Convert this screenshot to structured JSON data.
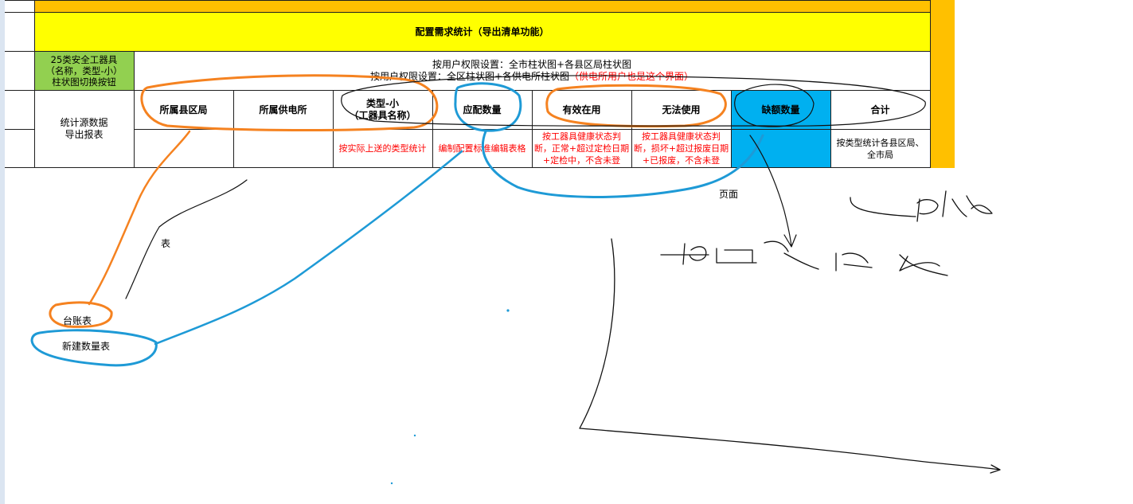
{
  "sheet": {
    "title": "配置需求统计（导出清单功能）",
    "green_button": {
      "line1": "25类安全工器具",
      "line2": "（名称，类型-小）",
      "line3": "柱状图切换按钮"
    },
    "permission_line1": "按用户权限设置：全市柱状图+各县区局柱状图",
    "permission_line2_prefix": "按用户权限设置：全区柱状图+各供电所柱状图",
    "permission_line2_red": "（供电所用户也是这个界面",
    "permission_line2_suffix": "）",
    "export_label_line1": "统计源数据",
    "export_label_line2": "导出报表",
    "headers": {
      "county": "所属县区局",
      "station": "所属供电所",
      "type_line1": "类型-小",
      "type_line2": "（工器具名称）",
      "required": "应配数量",
      "valid": "有效在用",
      "unusable": "无法使用",
      "shortage": "缺额数量",
      "total": "合计"
    },
    "notes": {
      "type": "按实际上送的类型统计",
      "required": "编制配置标准编辑表格",
      "valid": "按工器具健康状态判断，正常+超过定检日期+定检中，不含未登",
      "unusable": "按工器具健康状态判断，损坏+超过报废日期+已报废，不含未登",
      "total": "按类型统计各县区局、全市局"
    }
  },
  "annotations": {
    "ledger_table": "台账表",
    "new_qty_table": "新建数量表",
    "table_label": "表",
    "page_label": "页面"
  },
  "colors": {
    "orange_band": "#ffc000",
    "title_yellow": "#ffff00",
    "button_green": "#92d050",
    "shortage_blue": "#00b0f0",
    "orange_ink": "#f58220",
    "blue_ink": "#1e9ad6"
  }
}
